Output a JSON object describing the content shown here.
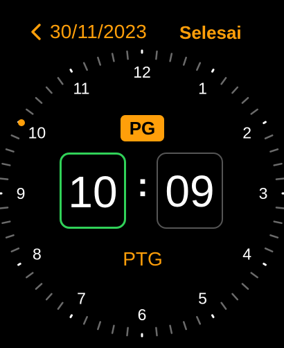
{
  "header": {
    "date": "30/11/2023",
    "done_label": "Selesai"
  },
  "clock": {
    "hour_numbers": [
      "12",
      "1",
      "2",
      "3",
      "4",
      "5",
      "6",
      "7",
      "8",
      "9",
      "10",
      "11"
    ],
    "selected_hour": "10"
  },
  "picker": {
    "ampm_selected": "PG",
    "hour": "10",
    "separator": ":",
    "minute": "09",
    "ampm_alternate": "PTG"
  },
  "colors": {
    "accent": "#ff9f0a",
    "selected_border": "#30d158",
    "unselected_border": "#555555",
    "tick": "#6b6b6b",
    "major_tick": "#ffffff",
    "background": "#000000"
  },
  "icons": {
    "back": "chevron-left-icon",
    "selected_marker": "selected-hour-dot-icon"
  }
}
